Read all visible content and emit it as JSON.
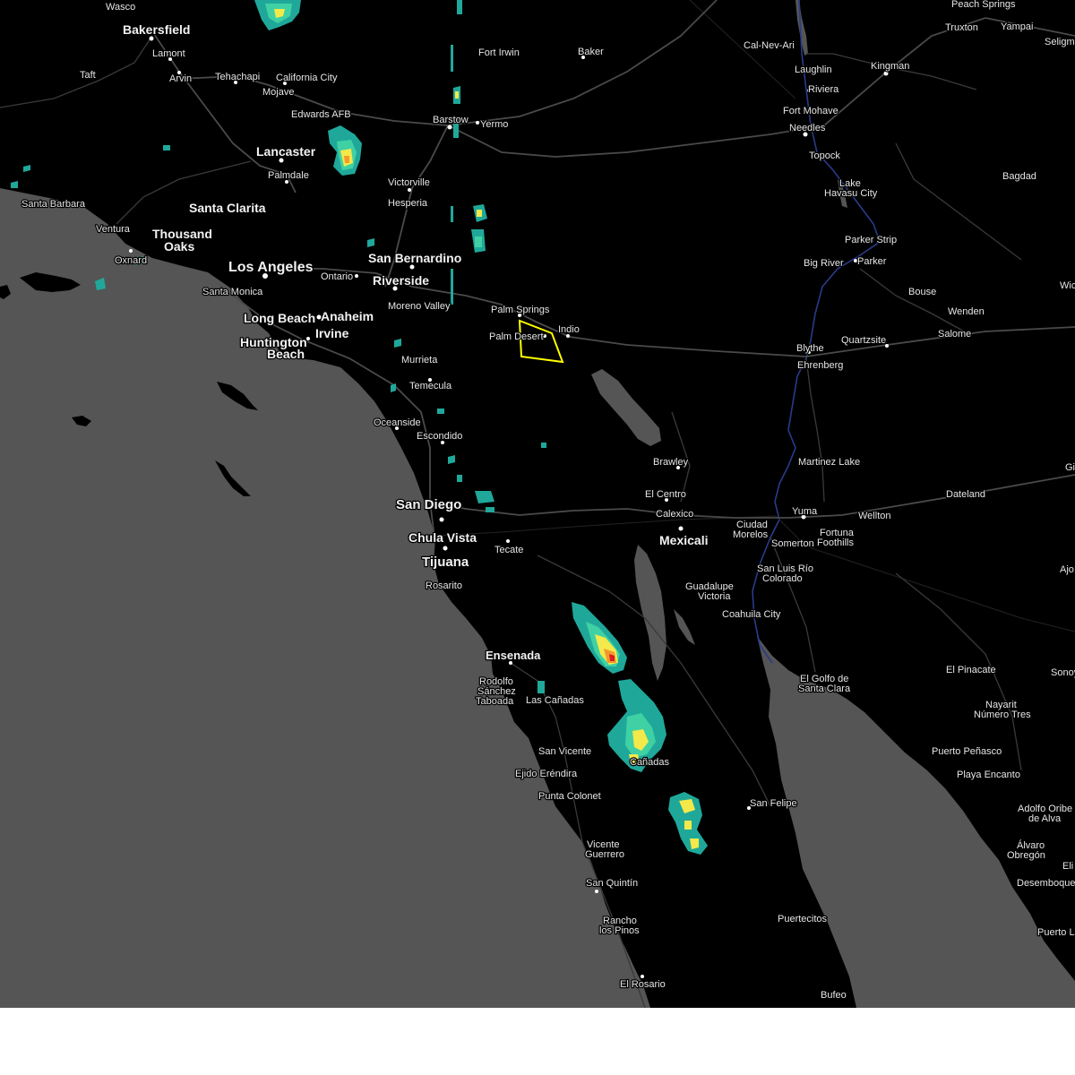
{
  "map": {
    "colors": {
      "land": "#000000",
      "water": "#555555",
      "warning_polygon": "#ffff00",
      "radar_light": "#1fa89a",
      "radar_mid": "#3fd1a4",
      "radar_yellow": "#f3e94a",
      "radar_orange": "#f29a2e",
      "radar_red": "#d81e1e"
    },
    "warning_polygon": {
      "type": "severe-thunderstorm-warning",
      "near": "Palm Desert"
    },
    "labels": {
      "wasco": "Wasco",
      "bakersfield": "Bakersfield",
      "lamont": "Lamont",
      "arvin": "Arvin",
      "taft": "Taft",
      "tehachapi": "Tehachapi",
      "california_city": "California City",
      "mojave": "Mojave",
      "edwards_afb": "Edwards AFB",
      "lancaster": "Lancaster",
      "palmdale": "Palmdale",
      "fort_irwin": "Fort Irwin",
      "baker": "Baker",
      "barstow": "Barstow",
      "yermo": "Yermo",
      "victorville": "Victorville",
      "hesperia": "Hesperia",
      "santa_barbara": "Santa Barbara",
      "ventura": "Ventura",
      "oxnard": "Oxnard",
      "santa_clarita": "Santa Clarita",
      "thousand": "Thousand",
      "oaks": "Oaks",
      "los_angeles": "Los Angeles",
      "santa_monica": "Santa Monica",
      "san_bernardino": "San Bernardino",
      "ontario": "Ontario",
      "riverside": "Riverside",
      "moreno_valley": "Moreno Valley",
      "long_beach": "Long Beach",
      "anaheim": "Anaheim",
      "irvine": "Irvine",
      "huntington": "Huntington",
      "beach": "Beach",
      "murrieta": "Murrieta",
      "temecula": "Temecula",
      "oceanside": "Oceanside",
      "escondido": "Escondido",
      "san_diego": "San Diego",
      "chula_vista": "Chula Vista",
      "tijuana": "Tijuana",
      "rosarito": "Rosarito",
      "tecate": "Tecate",
      "palm_springs": "Palm Springs",
      "palm_desert": "Palm Desert",
      "indio": "Indio",
      "brawley": "Brawley",
      "el_centro": "El Centro",
      "calexico": "Calexico",
      "mexicali": "Mexicali",
      "ensenada": "Ensenada",
      "rodolfo": "Rodolfo",
      "sanchez": "Sánchez",
      "taboada": "Taboada",
      "las_canadas": "Las Cañadas",
      "san_vicente": "San Vicente",
      "ejido_erendira": "Ejido Eréndira",
      "alamo_canadas": "Cañadas",
      "punta_colonet": "Punta Colonet",
      "vicente": "Vicente",
      "guerrero": "Guerrero",
      "san_quintin": "San Quintín",
      "rancho": "Rancho",
      "los_pinos": "los Pinos",
      "el_rosario": "El Rosario",
      "san_felipe": "San Felipe",
      "puertecitos": "Puertecitos",
      "bufeo": "Bufeo",
      "guadalupe": "Guadalupe",
      "victoria": "Victoria",
      "coahuila_city": "Coahuila City",
      "el_golfo_de": "El Golfo de",
      "santa_clara": "Santa Clara",
      "san_luis_rio": "San Luis Río",
      "colorado": "Colorado",
      "ciudad": "Ciudad",
      "morelos": "Morelos",
      "somerton": "Somerton",
      "yuma": "Yuma",
      "fortuna": "Fortuna",
      "foothills": "Foothills",
      "wellton": "Wellton",
      "dateland": "Dateland",
      "martinez_lake": "Martinez Lake",
      "blythe": "Blythe",
      "ehrenberg": "Ehrenberg",
      "quartzsite": "Quartzsite",
      "salome": "Salome",
      "wenden": "Wenden",
      "bouse": "Bouse",
      "parker": "Parker",
      "parker_strip": "Parker Strip",
      "big_river": "Big River",
      "bagdad": "Bagdad",
      "lake": "Lake",
      "havasu_city": "Havasu City",
      "topock": "Topock",
      "needles": "Needles",
      "fort_mohave": "Fort Mohave",
      "riviera": "Riviera",
      "laughlin": "Laughlin",
      "kingman": "Kingman",
      "cal_nev_ari": "Cal-Nev-Ari",
      "peach_springs": "Peach Springs",
      "truxton": "Truxton",
      "yampai": "Yampai",
      "seligman": "Seligm",
      "wic": "Wic",
      "el_pinacate": "El Pinacate",
      "sonoyta": "Sonoy",
      "nayarit": "Nayarit",
      "numero_tres": "Número Tres",
      "puerto_penasco": "Puerto Peñasco",
      "playa_encanto": "Playa Encanto",
      "adolfo_oribe": "Adolfo Oribe",
      "de_alva": "de Alva",
      "alvaro": "Álvaro",
      "obregon": "Obregón",
      "desemboque": "Desemboque",
      "puerto_l": "Puerto L",
      "ajo": "Ajo",
      "gi": "Gi",
      "eli": "Eli"
    }
  }
}
